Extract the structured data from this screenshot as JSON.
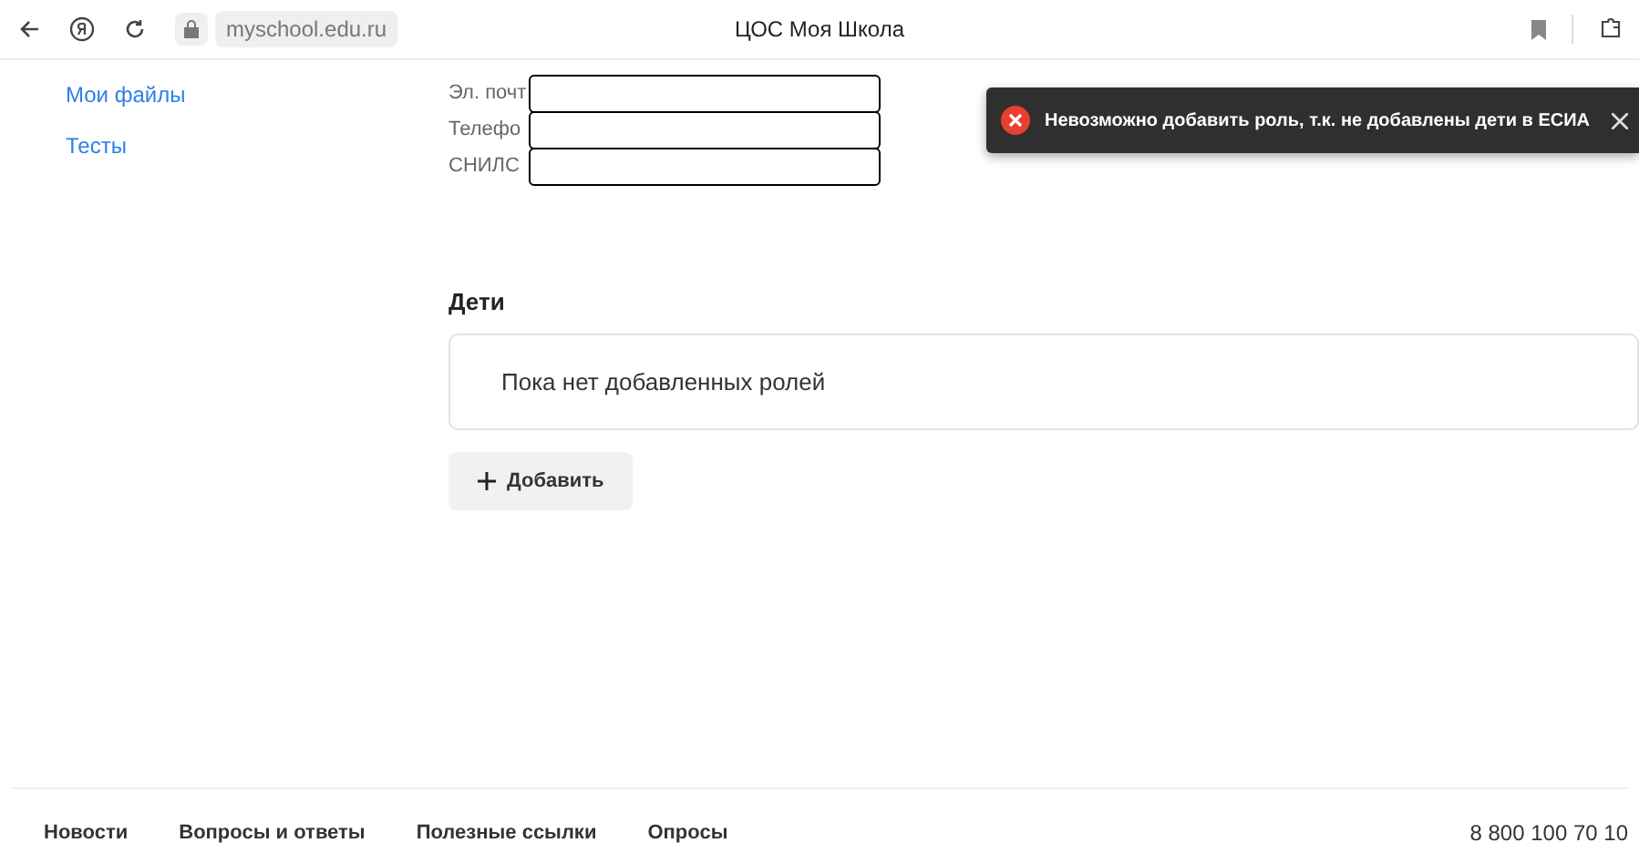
{
  "browser": {
    "address": "myschool.edu.ru",
    "title": "ЦОС Моя Школа"
  },
  "sidebar": {
    "items": [
      "Мои файлы",
      "Тесты"
    ]
  },
  "profile_fields": [
    {
      "label": "Эл. почт",
      "redacted": true
    },
    {
      "label": "Телефо",
      "redacted": true
    },
    {
      "label": "СНИЛС",
      "redacted": true
    }
  ],
  "children_section": {
    "title": "Дети",
    "empty_text": "Пока нет добавленных ролей",
    "add_button": "Добавить"
  },
  "toast": {
    "kind": "error",
    "message": "Невозможно добавить роль, т.к. не добавлены дети в ЕСИА"
  },
  "footer": {
    "links": [
      "Новости",
      "Вопросы и ответы",
      "Полезные ссылки",
      "Опросы"
    ],
    "phone": "8 800 100 70 10"
  }
}
